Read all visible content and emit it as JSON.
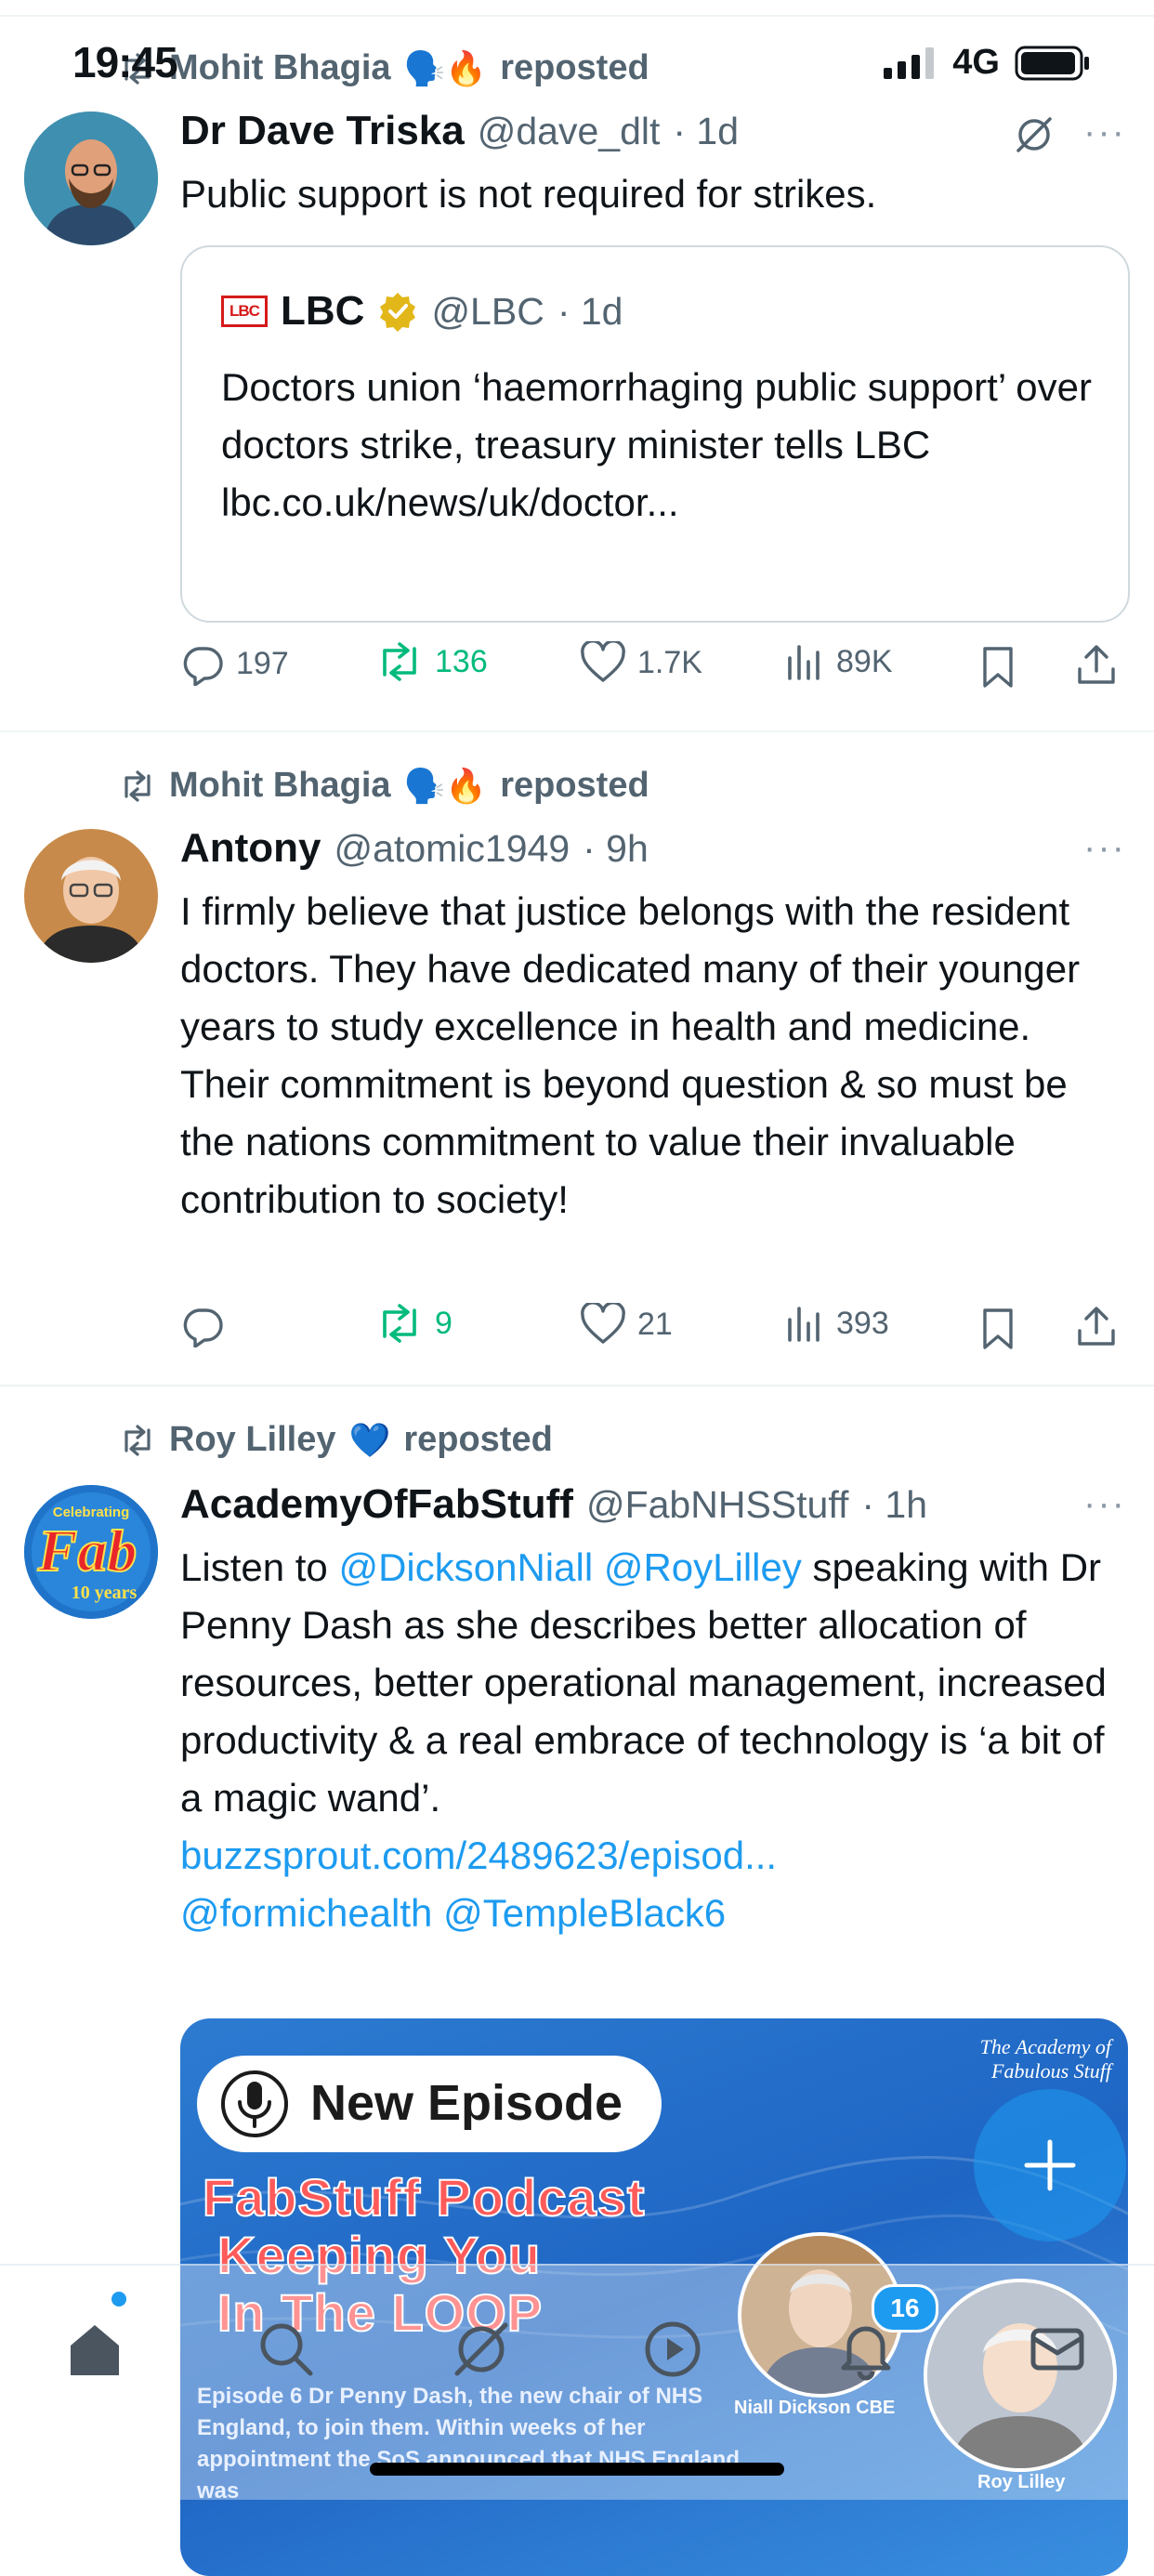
{
  "status_bar": {
    "time": "19:45",
    "network": "4G"
  },
  "tweets": [
    {
      "reposter": "Mohit Bhagia",
      "reposter_emojis": "🗣️🔥",
      "repost_label": "reposted",
      "name": "Dr Dave Triska",
      "handle": "@dave_dlt",
      "time": "· 1d",
      "text": "Public support is not required for strikes.",
      "quote": {
        "logo_text": "LBC",
        "name": "LBC",
        "handle": "@LBC",
        "time": "· 1d",
        "text": "Doctors union ‘haemorrhaging public support’ over doctors strike, treasury minister tells LBC",
        "link": "lbc.co.uk/news/uk/doctor..."
      },
      "replies": "197",
      "reposts": "136",
      "likes": "1.7K",
      "views": "89K"
    },
    {
      "reposter": "Mohit Bhagia",
      "reposter_emojis": "🗣️🔥",
      "repost_label": "reposted",
      "name": "Antony",
      "handle": "@atomic1949",
      "time": "· 9h",
      "text": "I firmly believe that justice belongs with the resident doctors. They have dedicated many of their younger years to study excellence in health and medicine. Their commitment is beyond question & so must be the nations commitment to value their invaluable contribution to society!",
      "replies": "",
      "reposts": "9",
      "likes": "21",
      "views": "393"
    },
    {
      "reposter": "Roy Lilley",
      "reposter_emojis": "💙",
      "repost_label": "reposted",
      "name": "AcademyOfFabStuff",
      "handle": "@FabNHSStuff",
      "time": "· 1h",
      "text_part1": "Listen to",
      "mention1": "@DicksonNiall",
      "mention2": "@RoyLilley",
      "text_part2": "speaking with Dr Penny Dash as she describes better allocation of resources, better operational management, increased productivity & a real embrace of technology is ‘a bit of a magic wand’.",
      "link": "buzzsprout.com/2489623/episod...",
      "mention3": "@formichealth",
      "mention4": "@TempleBlack6",
      "avatar_text_1": "Celebrating",
      "avatar_text_2": "Fab",
      "avatar_text_3": "10 years",
      "media": {
        "pill_text": "New Episode",
        "line1": "FabStuff Podcast",
        "line2": "Keeping You",
        "line3": "In The LOOP",
        "caption": "Episode 6 Dr Penny Dash, the new chair of NHS England, to join them. Within weeks of her appointment the SoS announced that NHS England was",
        "academy_label": "The Academy of Fabulous Stuff",
        "person1": "Niall Dickson CBE",
        "person2": "Roy Lilley"
      }
    }
  ],
  "bottom_nav": {
    "items": [
      "home",
      "search",
      "grok",
      "video",
      "notifications",
      "messages"
    ],
    "notifications_badge": "16"
  },
  "colors": {
    "accent": "#1d9bf0",
    "repost_green": "#00ba7c",
    "muted": "#536471"
  }
}
